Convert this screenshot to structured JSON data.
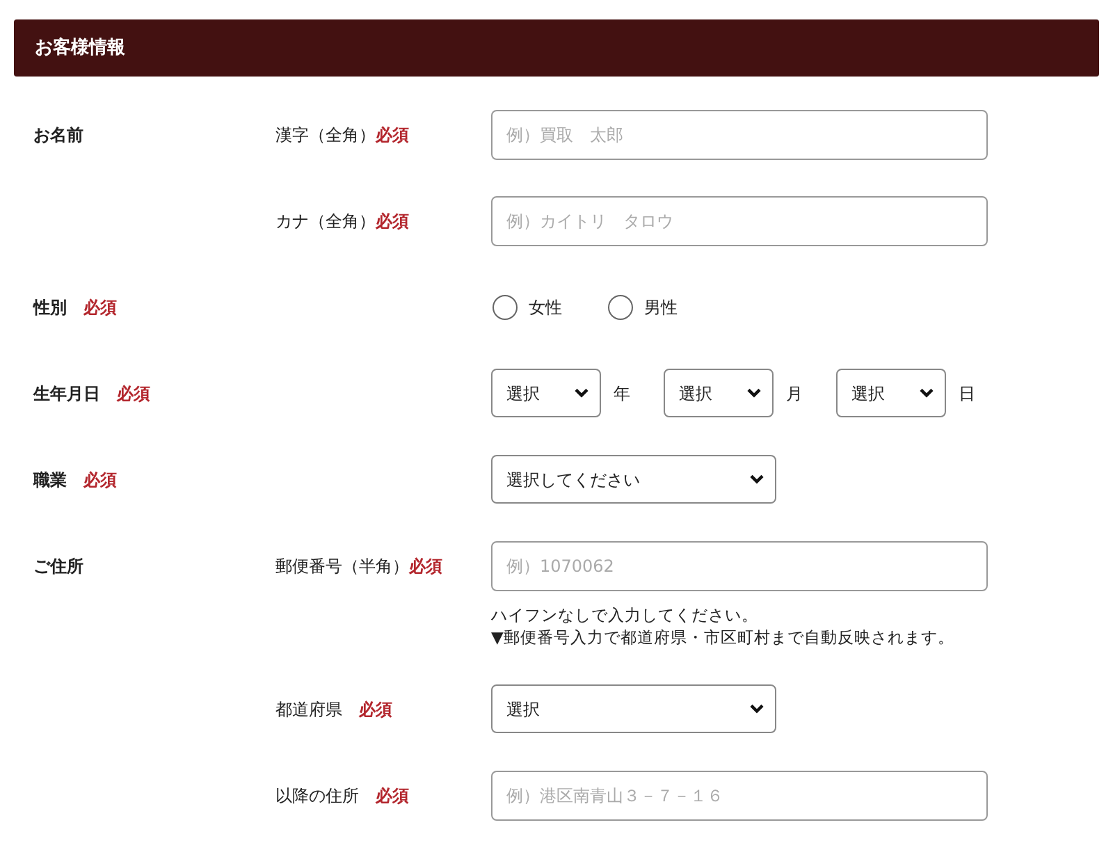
{
  "section_title": "お客様情報",
  "rows": [
    {
      "kind": "text",
      "label": "お名前",
      "sublabel": "漢字（全角）",
      "required_mark": "必須",
      "placeholder": "例）買取　太郎"
    },
    {
      "kind": "text",
      "sublabel": "カナ（全角）",
      "required_mark": "必須",
      "placeholder": "例）カイトリ　タロウ"
    },
    {
      "kind": "radio",
      "label": "性別",
      "required_mark": "必須",
      "options": [
        {
          "label": "女性",
          "selected": false
        },
        {
          "label": "男性",
          "selected": false
        }
      ]
    },
    {
      "kind": "date",
      "label": "生年月日",
      "required_mark": "必須",
      "selects": [
        {
          "value": "選択",
          "unit": "年"
        },
        {
          "value": "選択",
          "unit": "月"
        },
        {
          "value": "選択",
          "unit": "日"
        }
      ]
    },
    {
      "kind": "select",
      "label": "職業",
      "required_mark": "必須",
      "value": "選択してください"
    },
    {
      "kind": "text",
      "label": "ご住所",
      "sublabel": "郵便番号（半角）",
      "required_mark": "必須",
      "placeholder": "例）1070062",
      "notes": [
        "ハイフンなしで入力してください。",
        "▼郵便番号入力で都道府県・市区町村まで自動反映されます。"
      ]
    },
    {
      "kind": "select",
      "sublabel": "都道府県",
      "required_mark": "必須",
      "value": "選択"
    },
    {
      "kind": "text",
      "sublabel": "以降の住所",
      "required_mark": "必須",
      "placeholder": "例）港区南青山３－７－１６"
    }
  ]
}
